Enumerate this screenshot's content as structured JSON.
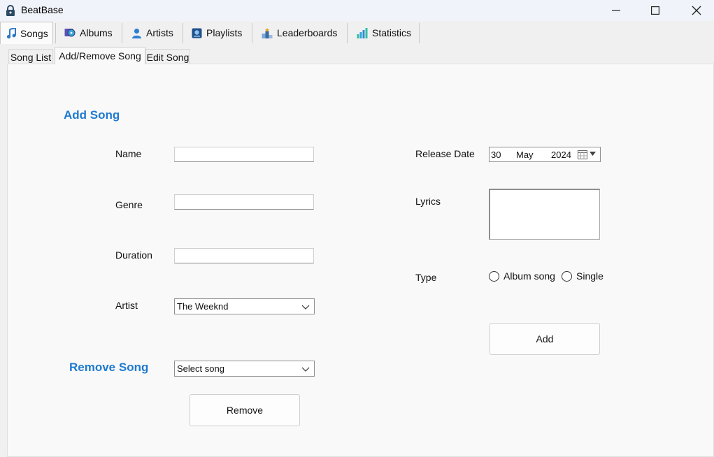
{
  "window": {
    "title": "BeatBase"
  },
  "main_tabs": [
    {
      "label": "Songs",
      "icon": "music-note-icon"
    },
    {
      "label": "Albums",
      "icon": "album-icon"
    },
    {
      "label": "Artists",
      "icon": "person-icon"
    },
    {
      "label": "Playlists",
      "icon": "playlist-icon"
    },
    {
      "label": "Leaderboards",
      "icon": "leaderboard-icon"
    },
    {
      "label": "Statistics",
      "icon": "bar-chart-icon"
    }
  ],
  "sub_tabs": [
    "Song List",
    "Add/Remove Song",
    "Edit Song"
  ],
  "add_song": {
    "title": "Add Song",
    "name_label": "Name",
    "genre_label": "Genre",
    "duration_label": "Duration",
    "artist_label": "Artist",
    "artist_value": "The Weeknd",
    "release_date_label": "Release Date",
    "release_day": "30",
    "release_month": "May",
    "release_year": "2024",
    "lyrics_label": "Lyrics",
    "type_label": "Type",
    "type_options": [
      "Album song",
      "Single"
    ],
    "add_button": "Add"
  },
  "remove_song": {
    "title": "Remove Song",
    "select_value": "Select song",
    "remove_button": "Remove"
  },
  "colors": {
    "accent": "#1e7ad1"
  }
}
